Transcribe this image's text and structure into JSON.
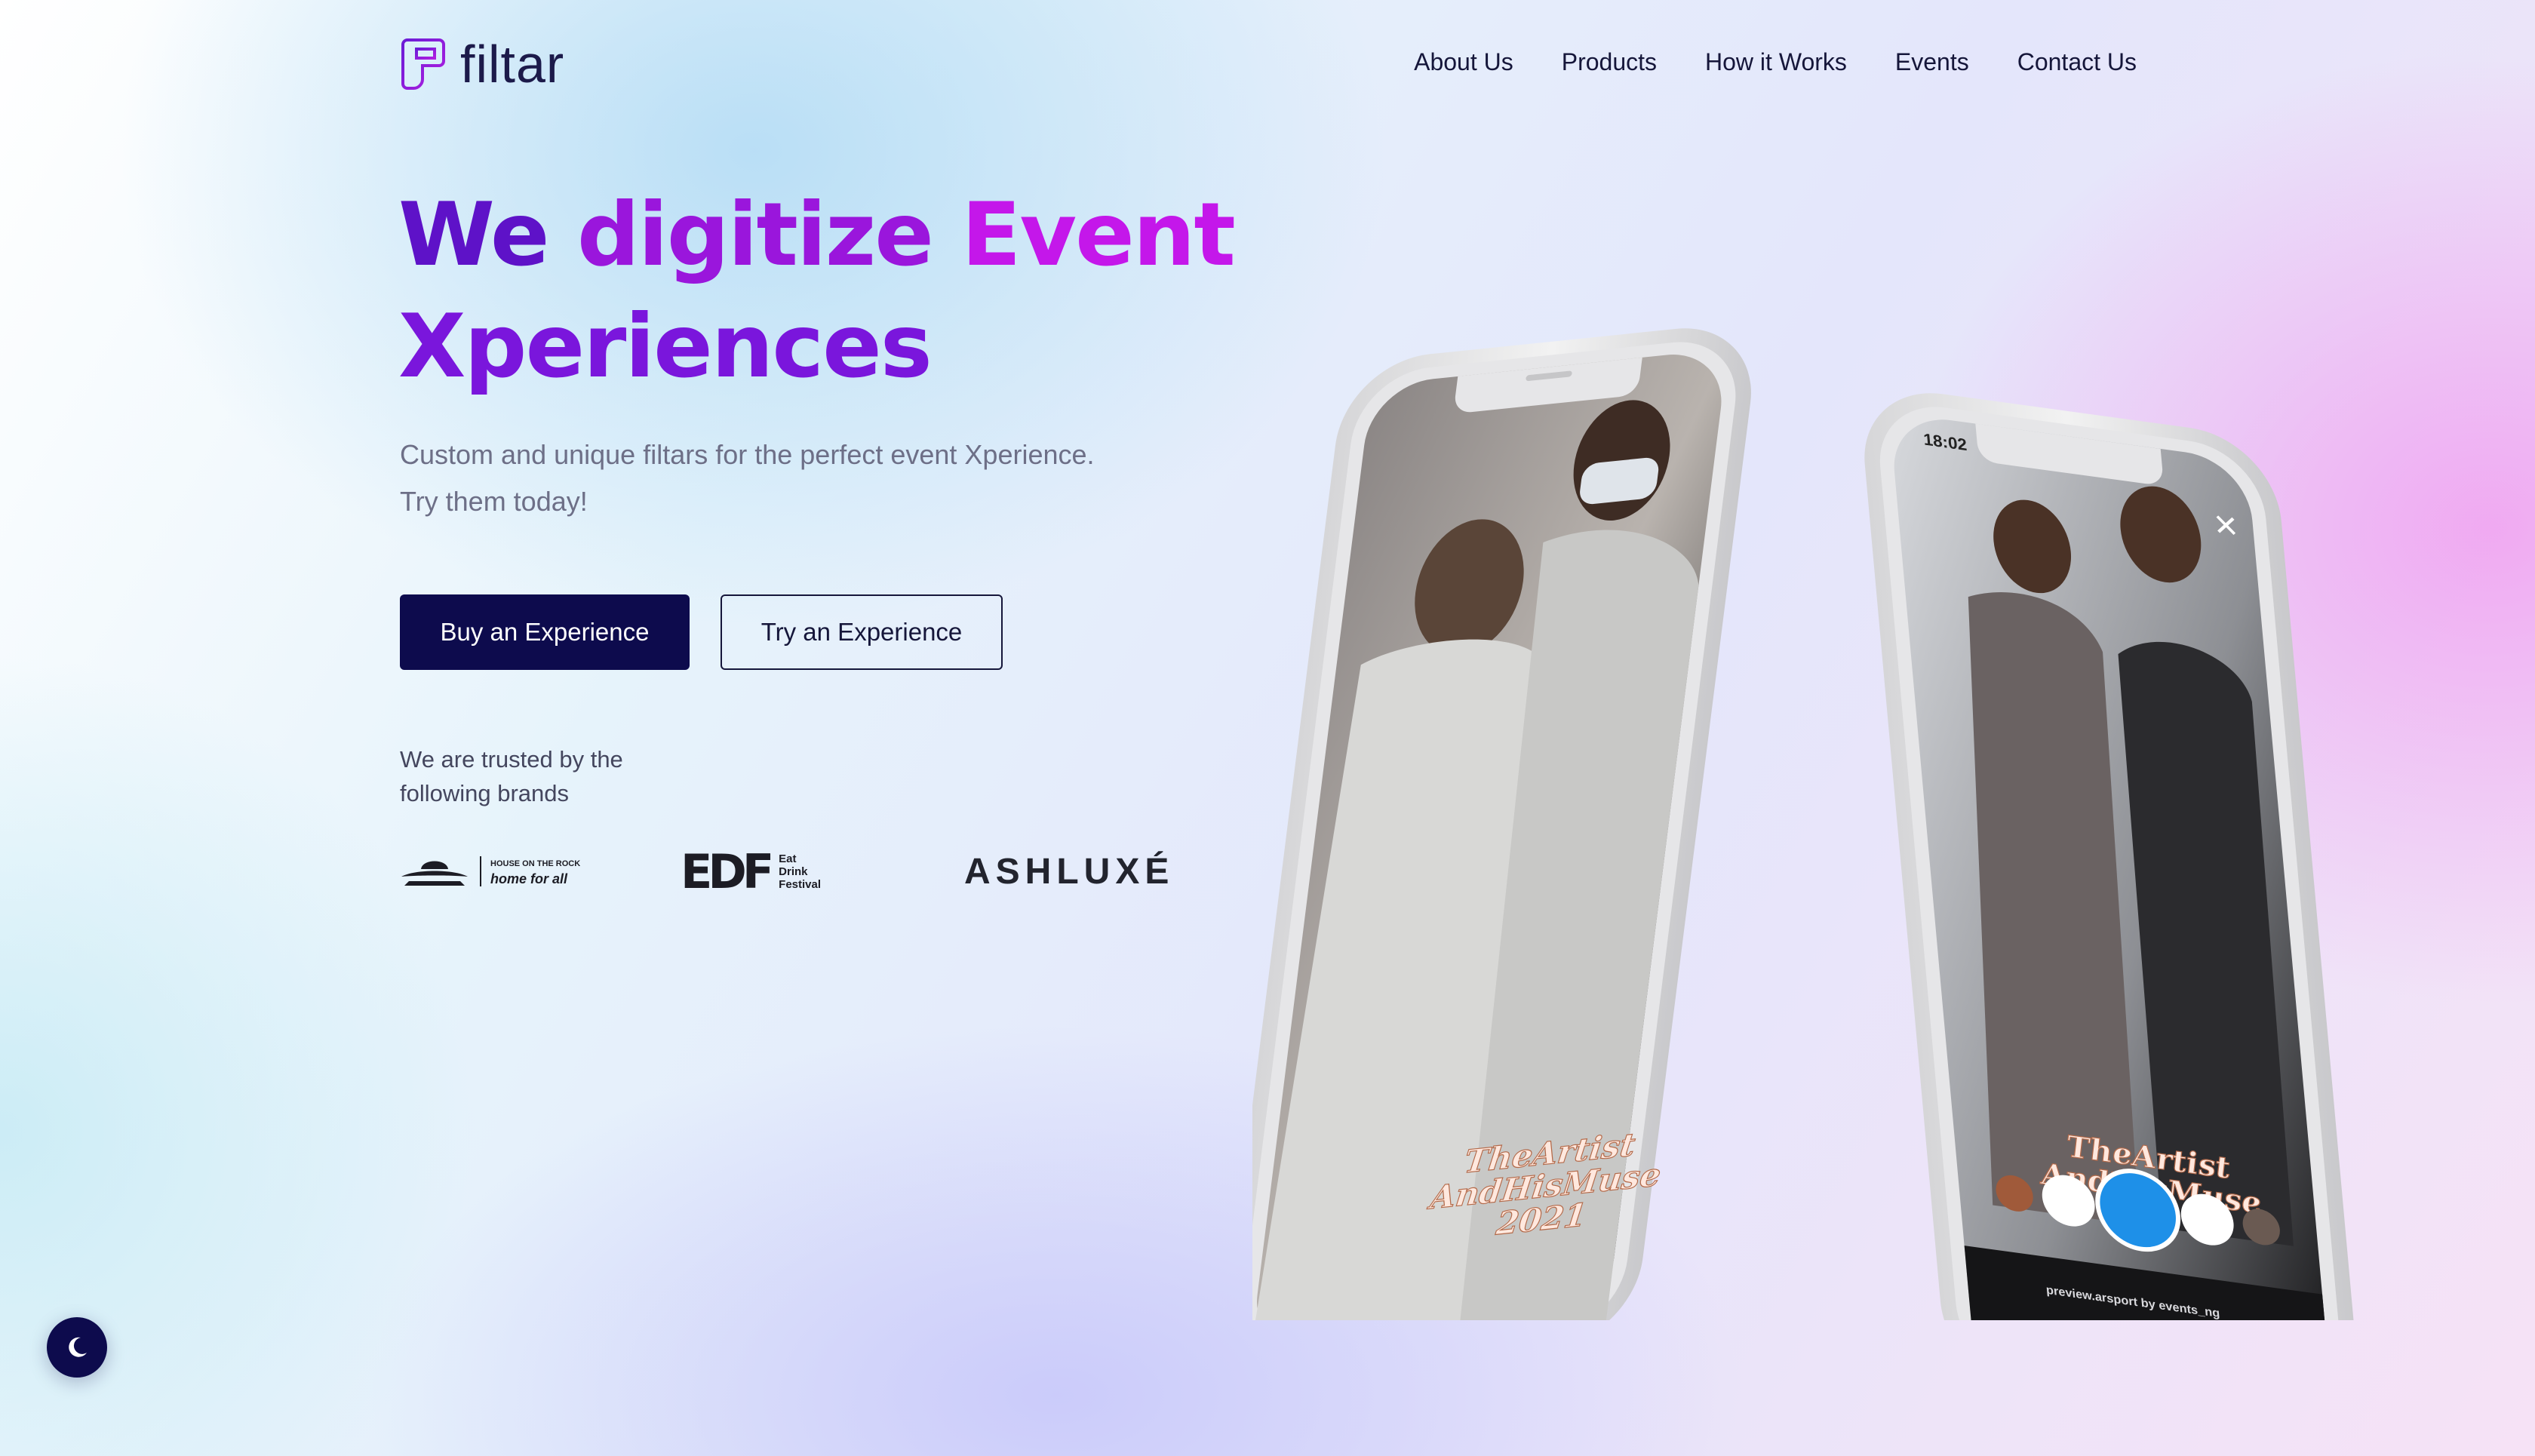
{
  "brand": {
    "name": "filtar",
    "logo_icon": "filtar-logo-icon"
  },
  "nav": {
    "items": [
      {
        "label": "About Us"
      },
      {
        "label": "Products"
      },
      {
        "label": "How it Works"
      },
      {
        "label": "Events"
      },
      {
        "label": "Contact Us"
      }
    ]
  },
  "hero": {
    "title_parts": [
      "We",
      "digitize",
      "Event",
      "Xperiences"
    ],
    "subtitle_line1": "Custom and unique filtars for the perfect event Xperience.",
    "subtitle_line2": "Try them today!",
    "primary_button": "Buy an Experience",
    "secondary_button": "Try an Experience"
  },
  "trusted": {
    "text_line1": "We are trusted by the",
    "text_line2": "following brands",
    "brands": [
      {
        "name": "HOUSE ON THE ROCK",
        "tagline": "home for all"
      },
      {
        "name": "EDF",
        "words": [
          "Eat",
          "Drink",
          "Festival"
        ]
      },
      {
        "name": "ASHLUXÉ"
      }
    ]
  },
  "phones": {
    "left_caption": [
      "TheArtist",
      "AndHisMuse",
      "2021"
    ],
    "right_caption": [
      "TheArtist",
      "AndHisMuse"
    ],
    "status_time": "18:02",
    "preview_text": "preview.arsport by events_ng"
  },
  "theme_toggle": {
    "icon": "moon-icon"
  },
  "colors": {
    "accent_dark": "#0d0b4d",
    "title_purple": "#5e12c8",
    "title_magenta": "#c417ea",
    "text_gray": "#6d6f87"
  }
}
